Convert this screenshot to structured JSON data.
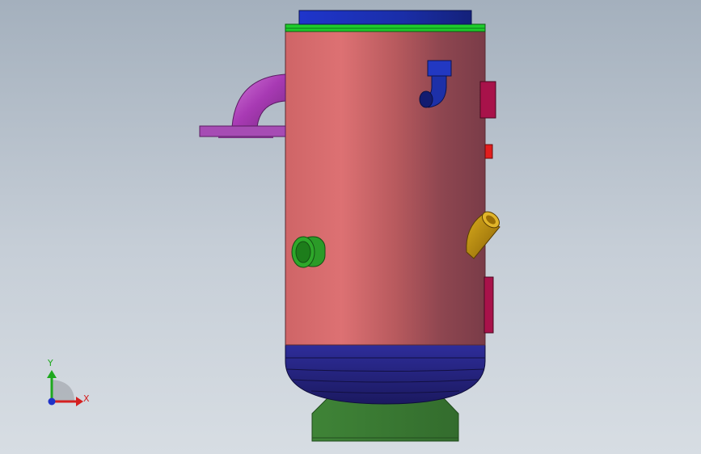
{
  "viewport": {
    "triad": {
      "x_label": "X",
      "y_label": "Y",
      "x_color": "#d42020",
      "y_color": "#1ea81e",
      "z_color": "#1f32c8"
    }
  },
  "model": {
    "vessel_shell_color": "#d86e70",
    "top_cap_color": "#1b2fbf",
    "flange_color": "#1ecc2c",
    "bottom_head_color": "#27258a",
    "skirt_color": "#3a7a34",
    "elbow_nozzle_color": "#b03ab8",
    "small_elbow_color": "#2030b0",
    "green_nozzle_color": "#2da52a",
    "gold_elbow_color": "#b8860b",
    "side_plate_color": "#a8124a",
    "red_stub_color": "#e21d1d"
  }
}
